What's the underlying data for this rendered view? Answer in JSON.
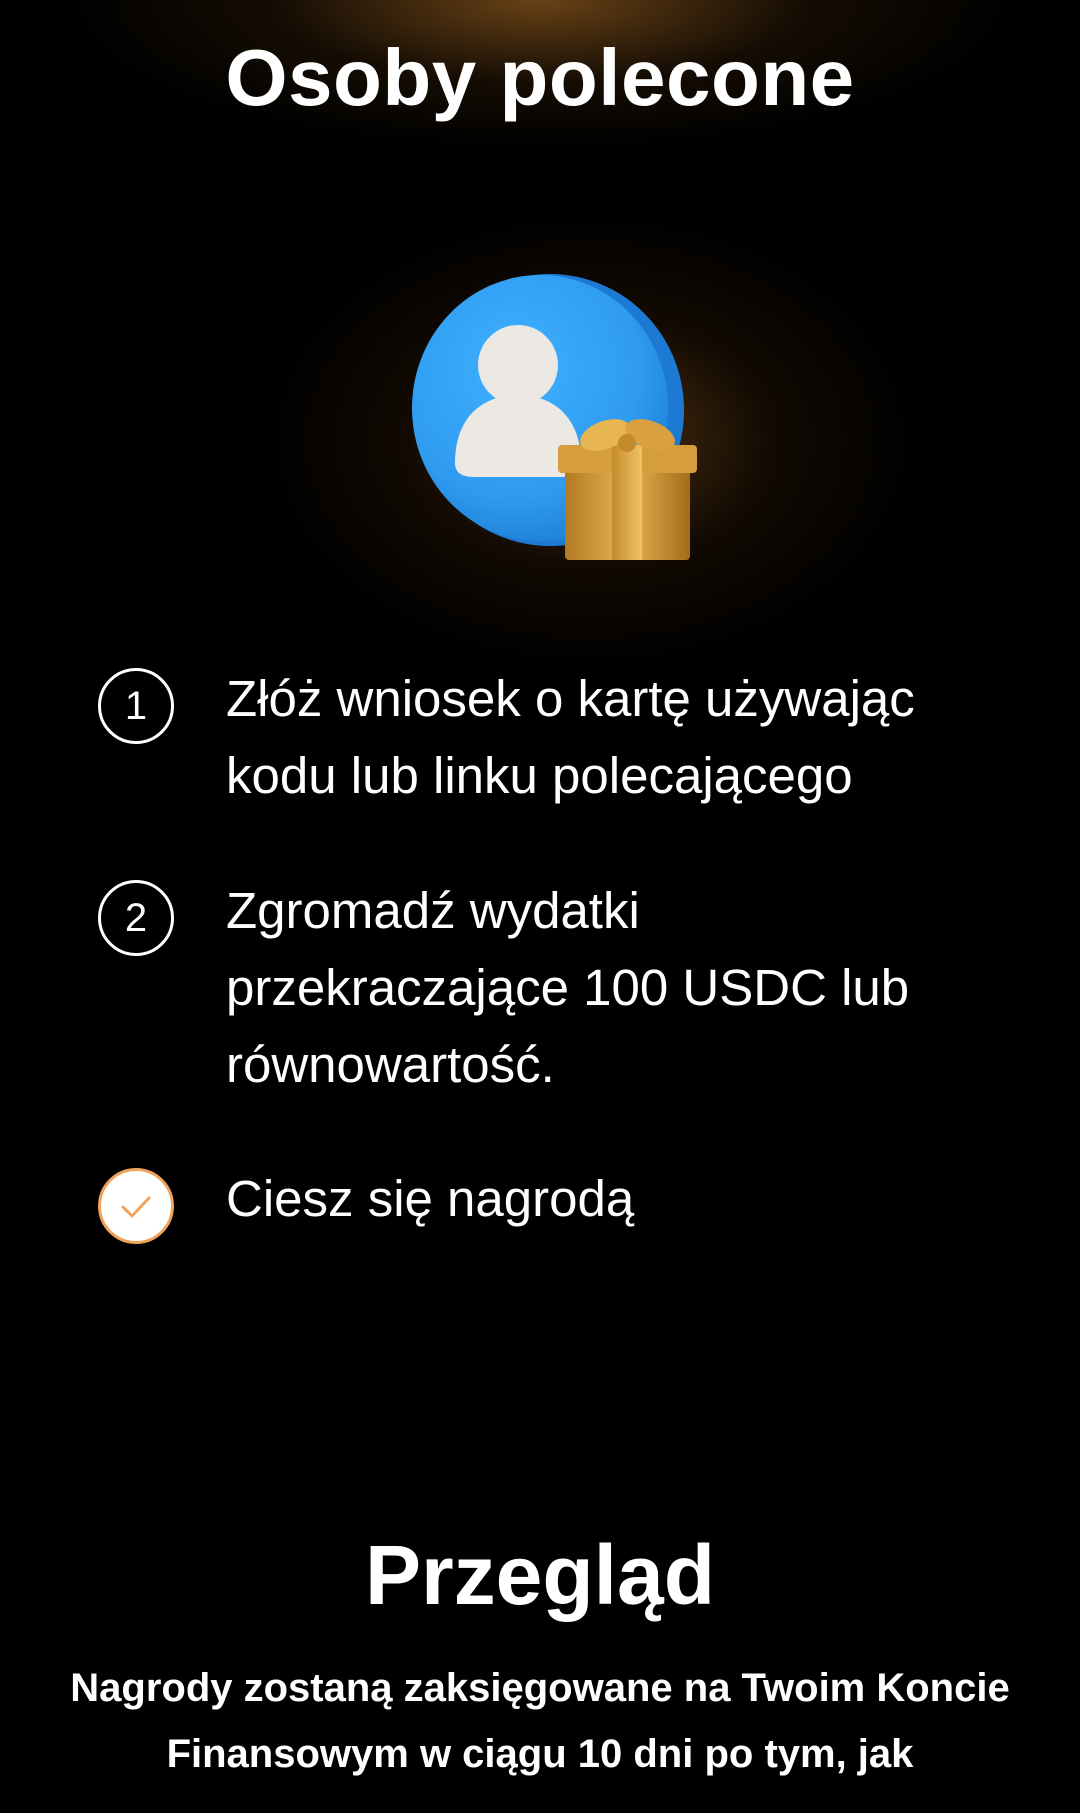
{
  "header": {
    "title": "Osoby polecone"
  },
  "hero": {
    "icon": "referral-gift-icon",
    "colors": {
      "circle": "#2e9bf0",
      "gift": "#d9a03a"
    }
  },
  "steps": [
    {
      "marker": "1",
      "text": "Złóż wniosek o kartę używając kodu lub linku polecającego",
      "status": "pending"
    },
    {
      "marker": "2",
      "text": "Zgromadź wydatki przekraczające 100 USDC lub równowartość.",
      "status": "pending"
    },
    {
      "marker": "check-icon",
      "text": "Ciesz się nagrodą",
      "status": "done"
    }
  ],
  "overview": {
    "title": "Przegląd",
    "body": "Nagrody zostaną zaksięgowane na Twoim Koncie Finansowym w ciągu 10 dni po tym, jak"
  },
  "colors": {
    "background": "#000000",
    "accent": "#f1a35b",
    "text": "#ffffff"
  }
}
